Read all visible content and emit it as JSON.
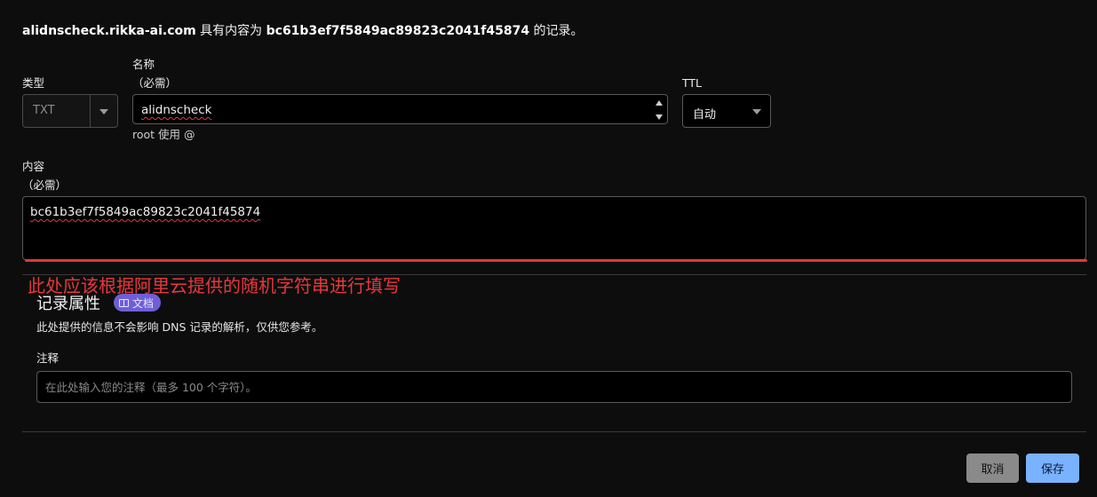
{
  "header": {
    "domain": "alidnscheck.rikka-ai.com",
    "middle": " 具有内容为 ",
    "record_value": "bc61b3ef7f5849ac89823c2041f45874",
    "suffix": " 的记录。"
  },
  "form": {
    "type": {
      "label": "类型",
      "value": "TXT"
    },
    "name": {
      "label": "名称",
      "required": "（必需）",
      "value": "alidnscheck",
      "hint": "root 使用 @"
    },
    "ttl": {
      "label": "TTL",
      "value": "自动"
    },
    "content": {
      "label": "内容",
      "required": "（必需）",
      "value": "bc61b3ef7f5849ac89823c2041f45874"
    }
  },
  "annotation": {
    "text": "此处应该根据阿里云提供的随机字符串进行填写",
    "color": "#e8383b"
  },
  "record_attributes": {
    "title": "记录属性",
    "doc_badge": "文档",
    "description": "此处提供的信息不会影响 DNS 记录的解析，仅供您参考。",
    "comment_label": "注释",
    "comment_placeholder": "在此处输入您的注释（最多 100 个字符）。"
  },
  "actions": {
    "cancel": "取消",
    "save": "保存"
  },
  "colors": {
    "accent_button": "#79b2ff",
    "badge": "#6e5fd8",
    "background": "#0d0d0d"
  }
}
